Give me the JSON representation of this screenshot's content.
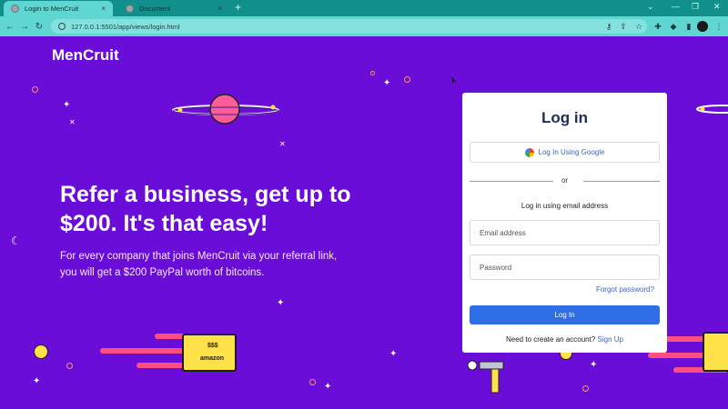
{
  "browser": {
    "tabs": [
      {
        "title": "Login to MenCruit",
        "active": true
      },
      {
        "title": "Document",
        "active": false
      }
    ],
    "url": "127.0.0.1:5501/app/views/login.html"
  },
  "page": {
    "logo": "MenCruit",
    "headline": "Refer a business, get up to $200. It's that easy!",
    "subtext": "For every company that joins MenCruit via your referral link, you will get a $200 PayPal worth of bitcoins.",
    "box_labels": {
      "price": "$$$",
      "brand": "amazon"
    }
  },
  "login": {
    "title": "Log in",
    "google_button": "Log In Using Google",
    "or": "or",
    "email_note": "Log in using email address",
    "email_placeholder": "Email address",
    "password_placeholder": "Password",
    "forgot_password": "Forgot password?",
    "submit": "Log In",
    "signup_prompt": "Need to create an account?",
    "signup_link": "Sign Up"
  },
  "colors": {
    "background": "#6a0dd9",
    "accent": "#2f6fe6",
    "browser_teal": "#118f8b"
  }
}
